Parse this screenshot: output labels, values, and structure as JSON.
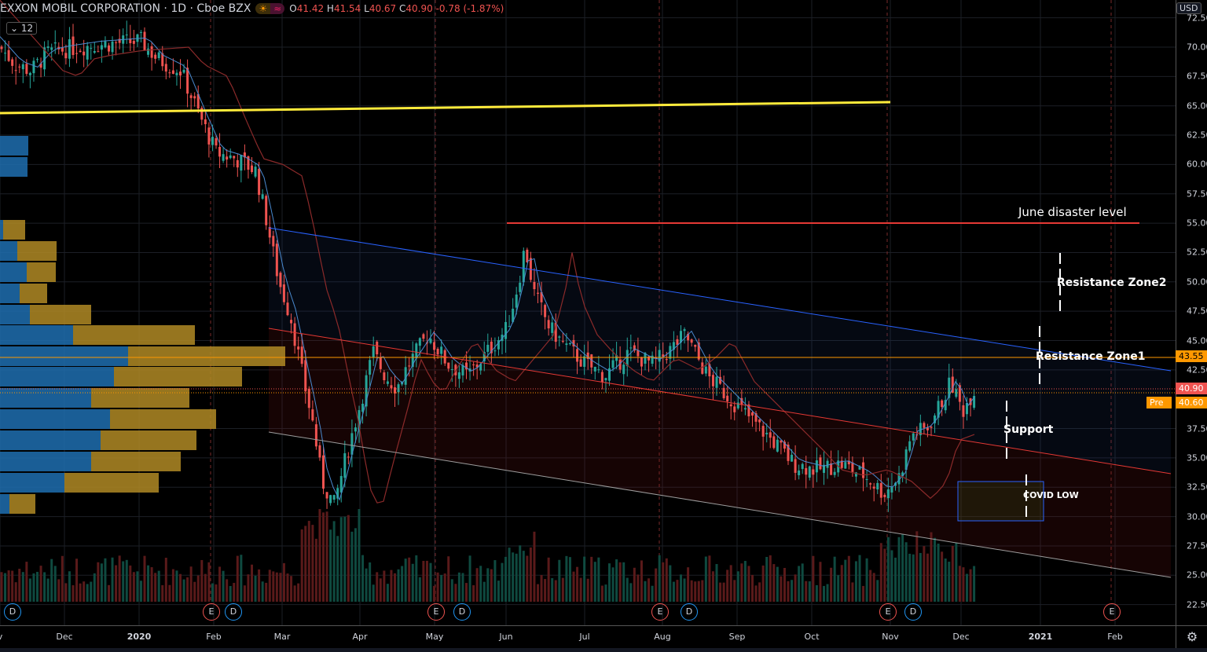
{
  "header": {
    "symbol": "EXXON MOBIL CORPORATION",
    "interval": "1D",
    "exchange": "Cboe BZX",
    "open": "41.42",
    "high": "41.54",
    "low": "40.67",
    "close": "40.90",
    "change": "-0.78 (-1.87%)",
    "o": "O",
    "h": "H",
    "l": "L",
    "c": "C"
  },
  "indicator_level": "12",
  "currency": "USD",
  "price_badges": {
    "level": "43.55",
    "last": "40.90",
    "pre_label": "Pre",
    "pre": "40.60"
  },
  "annotations": {
    "june": "June disaster level",
    "rz2": "Resistance Zone2",
    "rz1": "Resistance Zone1",
    "support": "Support",
    "covid": "COVID LOW"
  },
  "events": [
    {
      "t": "D",
      "k": "d"
    },
    {
      "t": "E",
      "k": "e"
    },
    {
      "t": "D",
      "k": "d"
    },
    {
      "t": "E",
      "k": "e"
    },
    {
      "t": "D",
      "k": "d"
    },
    {
      "t": "E",
      "k": "e"
    },
    {
      "t": "D",
      "k": "d"
    },
    {
      "t": "E",
      "k": "e"
    },
    {
      "t": "D",
      "k": "d"
    },
    {
      "t": "E",
      "k": "e"
    }
  ],
  "colors": {
    "up": "#26a69a",
    "down": "#ef5350",
    "yellow": "#ffeb3b",
    "orange": "#ff9800",
    "blue": "#2962ff",
    "red": "#e53935"
  },
  "chart_data": {
    "type": "candlestick",
    "title": "EXXON MOBIL CORPORATION · 1D · Cboe BZX",
    "ylim": [
      21,
      73.5
    ],
    "y_ticks": [
      "72.50",
      "70.00",
      "67.50",
      "65.00",
      "62.50",
      "60.00",
      "57.50",
      "55.00",
      "52.50",
      "50.00",
      "47.50",
      "45.00",
      "42.50",
      "37.50",
      "35.00",
      "32.50",
      "30.00",
      "27.50",
      "25.00",
      "22.50"
    ],
    "x_ticks": [
      "v",
      "Dec",
      "2020",
      "Feb",
      "Mar",
      "Apr",
      "May",
      "Jun",
      "Jul",
      "Aug",
      "Sep",
      "Oct",
      "Nov",
      "Dec",
      "2021",
      "Feb"
    ],
    "closes_keypoints": [
      [
        0,
        70
      ],
      [
        20,
        68.5
      ],
      [
        40,
        68
      ],
      [
        60,
        69.5
      ],
      [
        80,
        69.8
      ],
      [
        120,
        70.2
      ],
      [
        180,
        70.5
      ],
      [
        200,
        69
      ],
      [
        230,
        68
      ],
      [
        255,
        64
      ],
      [
        275,
        61
      ],
      [
        300,
        60.5
      ],
      [
        325,
        59.5
      ],
      [
        340,
        55
      ],
      [
        355,
        50
      ],
      [
        370,
        47
      ],
      [
        385,
        42
      ],
      [
        398,
        38
      ],
      [
        410,
        33
      ],
      [
        425,
        31
      ],
      [
        440,
        35
      ],
      [
        460,
        40
      ],
      [
        475,
        44
      ],
      [
        490,
        42
      ],
      [
        505,
        41
      ],
      [
        520,
        43
      ],
      [
        545,
        45.5
      ],
      [
        570,
        43
      ],
      [
        595,
        42
      ],
      [
        620,
        44
      ],
      [
        645,
        46
      ],
      [
        660,
        50
      ],
      [
        668,
        53
      ],
      [
        680,
        49
      ],
      [
        700,
        46
      ],
      [
        720,
        44.5
      ],
      [
        745,
        43
      ],
      [
        770,
        42
      ],
      [
        800,
        44
      ],
      [
        830,
        43
      ],
      [
        850,
        44
      ],
      [
        872,
        45.5
      ],
      [
        900,
        42
      ],
      [
        930,
        40
      ],
      [
        960,
        38
      ],
      [
        990,
        36
      ],
      [
        1010,
        34.5
      ],
      [
        1040,
        34
      ],
      [
        1070,
        34.5
      ],
      [
        1100,
        33.5
      ],
      [
        1125,
        32
      ],
      [
        1145,
        33.5
      ],
      [
        1160,
        37
      ],
      [
        1180,
        37.5
      ],
      [
        1200,
        40
      ],
      [
        1210,
        41.5
      ],
      [
        1225,
        39
      ],
      [
        1240,
        40.9
      ]
    ]
  }
}
